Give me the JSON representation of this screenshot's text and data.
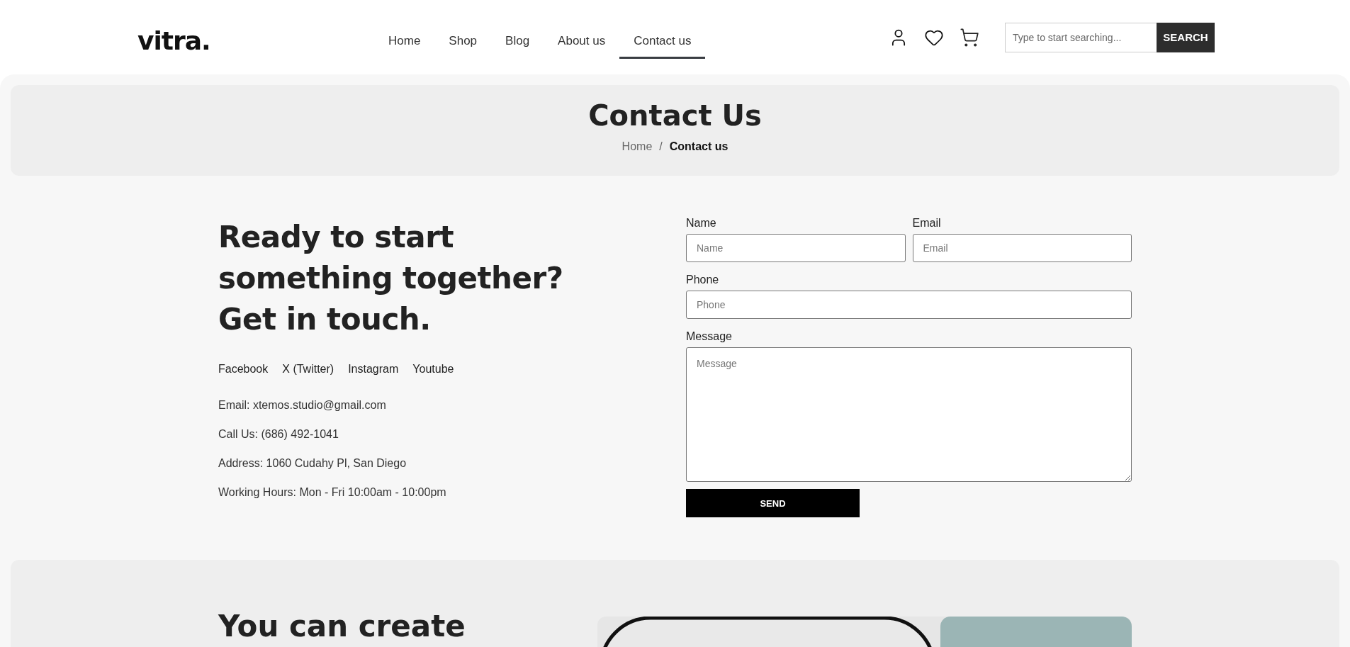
{
  "header": {
    "logo": "vitra.",
    "nav": [
      {
        "label": "Home",
        "selected": false
      },
      {
        "label": "Shop",
        "selected": false
      },
      {
        "label": "Blog",
        "selected": false
      },
      {
        "label": "About us",
        "selected": false
      },
      {
        "label": "Contact us",
        "selected": true
      }
    ],
    "search": {
      "placeholder": "Type to start searching...",
      "button": "SEARCH"
    }
  },
  "banner": {
    "title": "Contact Us",
    "separator": "/",
    "breadcrumb": [
      {
        "label": "Home",
        "current": false
      },
      {
        "label": "Contact us",
        "current": true
      }
    ]
  },
  "contact": {
    "heading_lines": [
      "Ready to start",
      "something together?",
      "Get in touch."
    ],
    "socials": [
      "Facebook",
      "X (Twitter)",
      "Instagram",
      "Youtube"
    ],
    "details": [
      "Email: xtemos.studio@gmail.com",
      "Call Us: (686) 492-1041",
      "Address: 1060 Cudahy Pl, San Diego",
      "Working Hours: Mon - Fri 10:00am - 10:00pm"
    ]
  },
  "form": {
    "fields": [
      {
        "label": "Name",
        "placeholder": "Name",
        "kind": "input",
        "full_width": false
      },
      {
        "label": "Email",
        "placeholder": "Email",
        "kind": "input",
        "full_width": false
      },
      {
        "label": "Phone",
        "placeholder": "Phone",
        "kind": "input",
        "full_width": true
      },
      {
        "label": "Message",
        "placeholder": "Message",
        "kind": "textarea",
        "full_width": true
      }
    ],
    "button": "SEND"
  },
  "promo": {
    "heading": "You can create"
  }
}
